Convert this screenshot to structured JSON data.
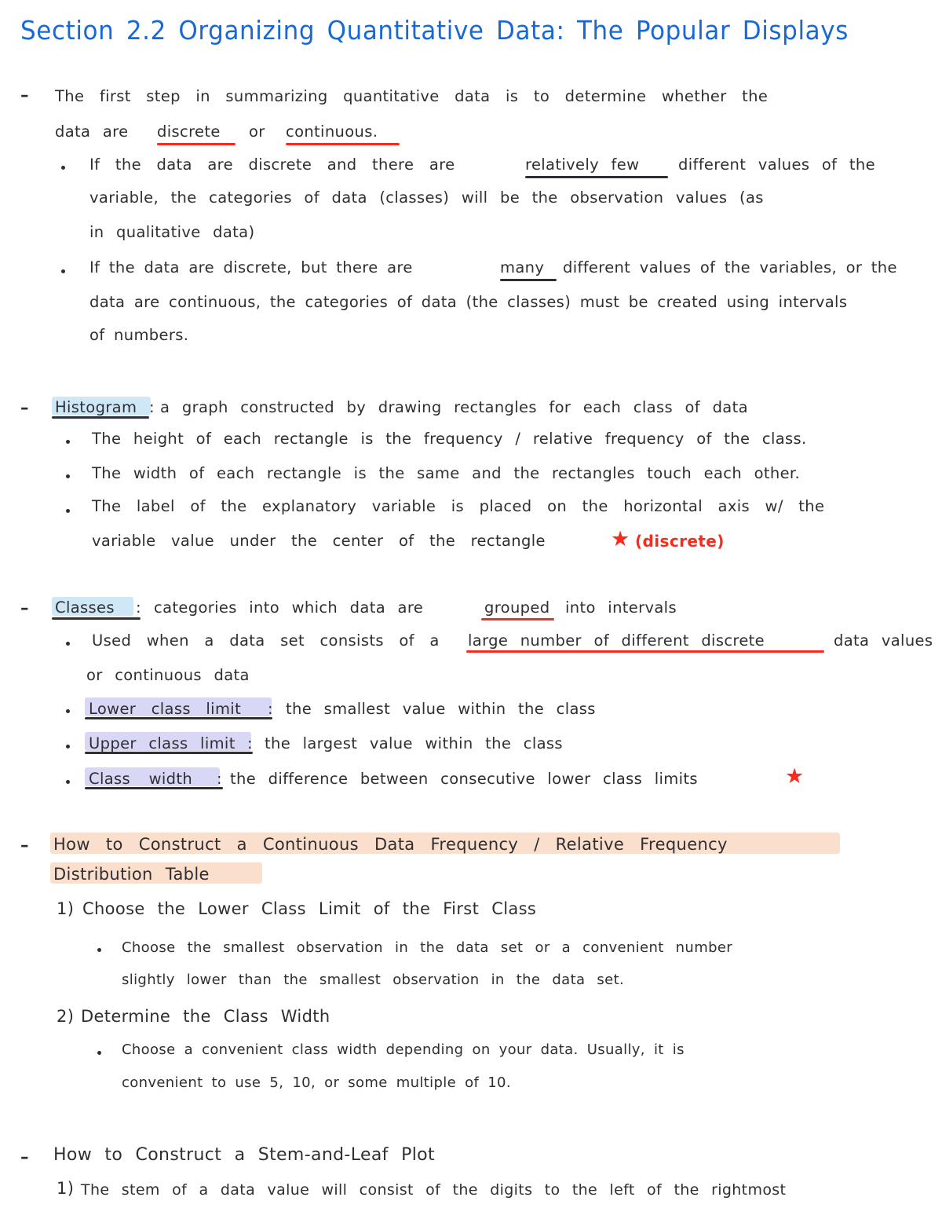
{
  "document": {
    "title": "Section 2.2 Organizing Quantitative Data: The Popular Displays",
    "title_color": "#1868d6",
    "ink_color": "#2f2f33",
    "accent_red": "#fb2a1d",
    "highlight_blue": "#cfe8f7",
    "highlight_purple": "#d8d8f6",
    "highlight_peach": "#fbdfcd"
  },
  "sections": {
    "first_step": {
      "bullet": "–",
      "line1": "The first step in summarizing quantitative data is to determine whether the",
      "line2_pre": "data are",
      "line2_term1": "discrete",
      "line2_mid": "or",
      "line2_term2": "continuous.",
      "sub1": {
        "marker": "•",
        "line1_pre": "If the data are discrete and there are",
        "line1_emph": "relatively few",
        "line1_post": "different values of the",
        "line2": "variable, the categories of data (classes) will be the observation values (as",
        "line3": "in qualitative data)"
      },
      "sub2": {
        "marker": "•",
        "line1_pre": "If the data are discrete, but there are",
        "line1_emph": "many",
        "line1_post": "different values of the variables, or the",
        "line2": "data are continuous, the categories of data (the classes) must be created using intervals",
        "line3": "of numbers."
      }
    },
    "histogram": {
      "bullet": "–",
      "term": "Histogram",
      "colon": ":",
      "definition": "a graph constructed by drawing rectangles for each class of data",
      "sub": [
        "The height of each rectangle is the frequency / relative frequency of the class.",
        "The width of each rectangle is the same and the rectangles touch each other.",
        "The label of the explanatory variable is placed on the horizontal axis w/ the"
      ],
      "sub3_cont": "variable value under the center of the rectangle",
      "annotation_star": "★",
      "annotation_text": "(discrete)"
    },
    "classes": {
      "bullet": "–",
      "term": "Classes",
      "colon": ":",
      "def_pre": "categories into which data are",
      "def_emph": "grouped",
      "def_post": "into intervals",
      "sub_used": {
        "marker": "•",
        "line1_pre": "Used when a data set consists of a",
        "line1_emph": "large number of different discrete",
        "line1_post": "data values",
        "line2": "or continuous data"
      },
      "lower_limit": {
        "marker": "•",
        "term": "Lower class limit",
        "colon": ":",
        "definition": "the smallest value within the class"
      },
      "upper_limit": {
        "marker": "•",
        "term": "Upper class limit",
        "colon": ":",
        "definition": "the largest value within the class"
      },
      "class_width": {
        "marker": "•",
        "term": "Class width",
        "colon": ":",
        "definition": "the difference between consecutive lower class limits",
        "star": "★"
      }
    },
    "construct_table": {
      "bullet": "–",
      "heading_line1": "How to Construct a Continuous Data Frequency / Relative Frequency",
      "heading_line2": "Distribution Table",
      "step1": {
        "number": "1)",
        "text": "Choose the Lower Class Limit of the First Class",
        "sub": {
          "marker": "•",
          "line1": "Choose the smallest observation in the data set or a convenient number",
          "line2": "slightly lower than the smallest observation in the data set."
        }
      },
      "step2": {
        "number": "2)",
        "text": "Determine the Class Width",
        "sub": {
          "marker": "•",
          "line1": "Choose a convenient class width depending on your data. Usually, it is",
          "line2": "convenient to use 5, 10, or some multiple of 10."
        }
      }
    },
    "stem_and_leaf": {
      "bullet": "–",
      "heading": "How to Construct a Stem-and-Leaf Plot",
      "step1": {
        "number": "1)",
        "text": "The stem of a data value will consist of the digits to the left of the rightmost"
      }
    }
  }
}
